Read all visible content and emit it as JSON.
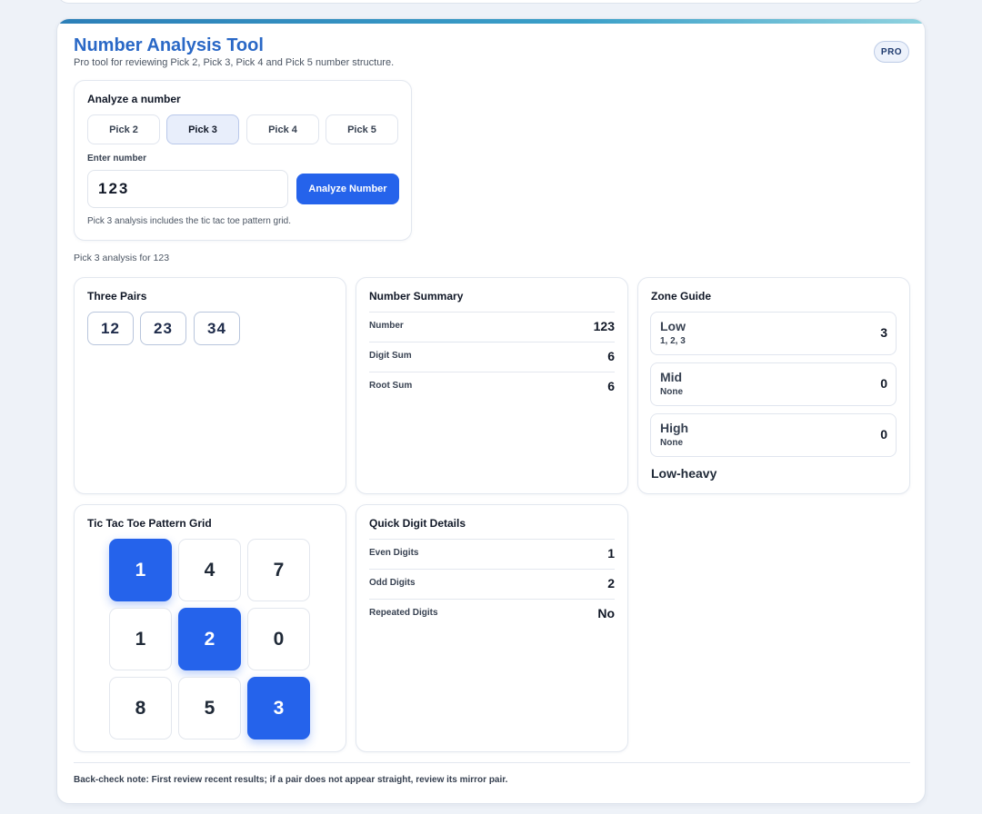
{
  "header": {
    "title": "Number Analysis Tool",
    "subtitle": "Pro tool for reviewing Pick 2, Pick 3, Pick 4 and Pick 5 number structure.",
    "badge": "PRO"
  },
  "analyze": {
    "title": "Analyze a number",
    "picks": [
      "Pick 2",
      "Pick 3",
      "Pick 4",
      "Pick 5"
    ],
    "active_pick": "Pick 3",
    "input_label": "Enter number",
    "input_value": "123",
    "button_label": "Analyze Number",
    "hint": "Pick 3 analysis includes the tic tac toe pattern grid."
  },
  "analysis_caption": "Pick 3 analysis for 123",
  "three_pairs": {
    "title": "Three Pairs",
    "pairs": [
      "12",
      "23",
      "34"
    ]
  },
  "summary": {
    "title": "Number Summary",
    "rows": [
      {
        "label": "Number",
        "value": "123"
      },
      {
        "label": "Digit Sum",
        "value": "6"
      },
      {
        "label": "Root Sum",
        "value": "6"
      }
    ]
  },
  "zones": {
    "title": "Zone Guide",
    "items": [
      {
        "name": "Low",
        "digits": "1, 2, 3",
        "count": "3"
      },
      {
        "name": "Mid",
        "digits": "None",
        "count": "0"
      },
      {
        "name": "High",
        "digits": "None",
        "count": "0"
      }
    ],
    "verdict": "Low-heavy"
  },
  "ttt": {
    "title": "Tic Tac Toe Pattern Grid",
    "cells": [
      {
        "value": "1",
        "hit": true
      },
      {
        "value": "4",
        "hit": false
      },
      {
        "value": "7",
        "hit": false
      },
      {
        "value": "1",
        "hit": false
      },
      {
        "value": "2",
        "hit": true
      },
      {
        "value": "0",
        "hit": false
      },
      {
        "value": "8",
        "hit": false
      },
      {
        "value": "5",
        "hit": false
      },
      {
        "value": "3",
        "hit": true
      }
    ]
  },
  "digits": {
    "title": "Quick Digit Details",
    "rows": [
      {
        "label": "Even Digits",
        "value": "1"
      },
      {
        "label": "Odd Digits",
        "value": "2"
      },
      {
        "label": "Repeated Digits",
        "value": "No"
      }
    ]
  },
  "footnote": "Back-check note: First review recent results; if a pair does not appear straight, review its mirror pair.",
  "colors": {
    "accent": "#2563eb",
    "title": "#2a68c6"
  }
}
